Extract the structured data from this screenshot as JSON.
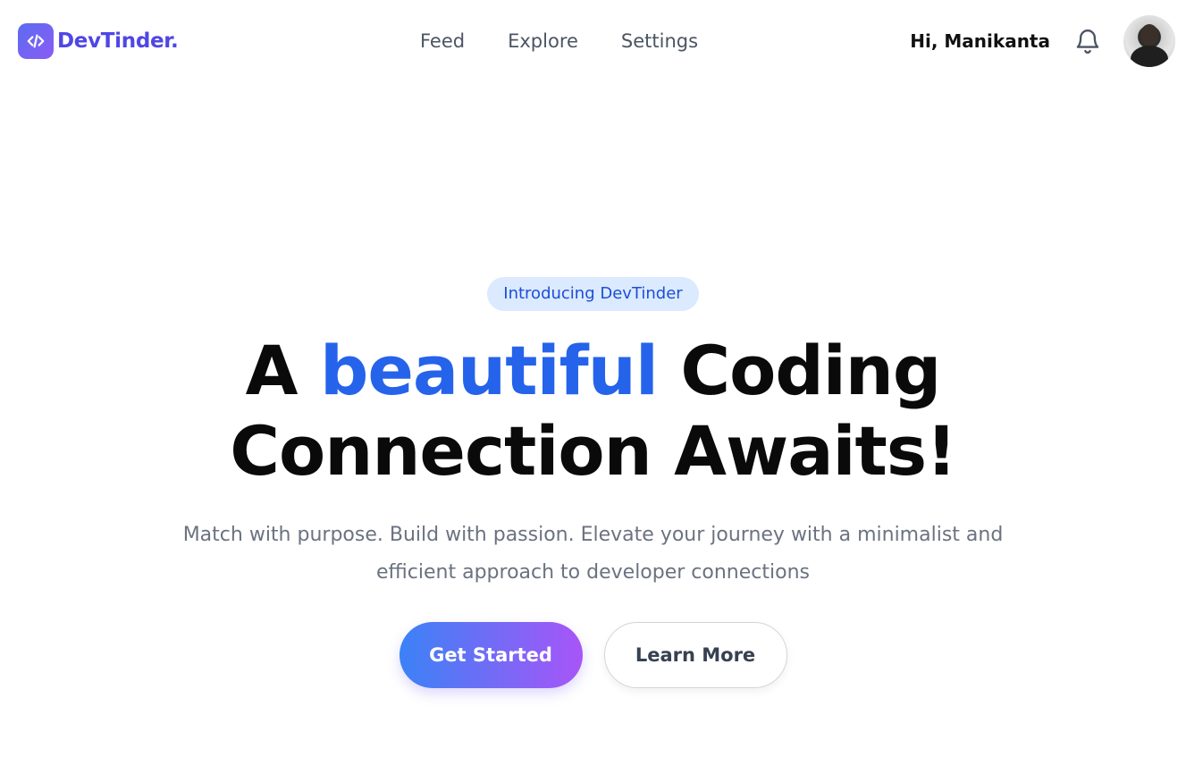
{
  "brand": {
    "name": "DevTinder.",
    "logo_icon": "code-icon",
    "color": "#4f46e5"
  },
  "nav": {
    "links": [
      {
        "label": "Feed"
      },
      {
        "label": "Explore"
      },
      {
        "label": "Settings"
      }
    ]
  },
  "user": {
    "greeting": "Hi, Manikanta",
    "notification_icon": "bell-icon",
    "avatar_icon": "avatar"
  },
  "hero": {
    "badge": "Introducing DevTinder",
    "headline_part1": "A ",
    "headline_accent": "beautiful",
    "headline_part2": " Coding Connection Awaits!",
    "subtext": "Match with purpose. Build with passion. Elevate your journey with a minimalist and efficient approach to developer connections",
    "primary_cta": "Get Started",
    "secondary_cta": "Learn More",
    "accent_color": "#2563eb"
  }
}
